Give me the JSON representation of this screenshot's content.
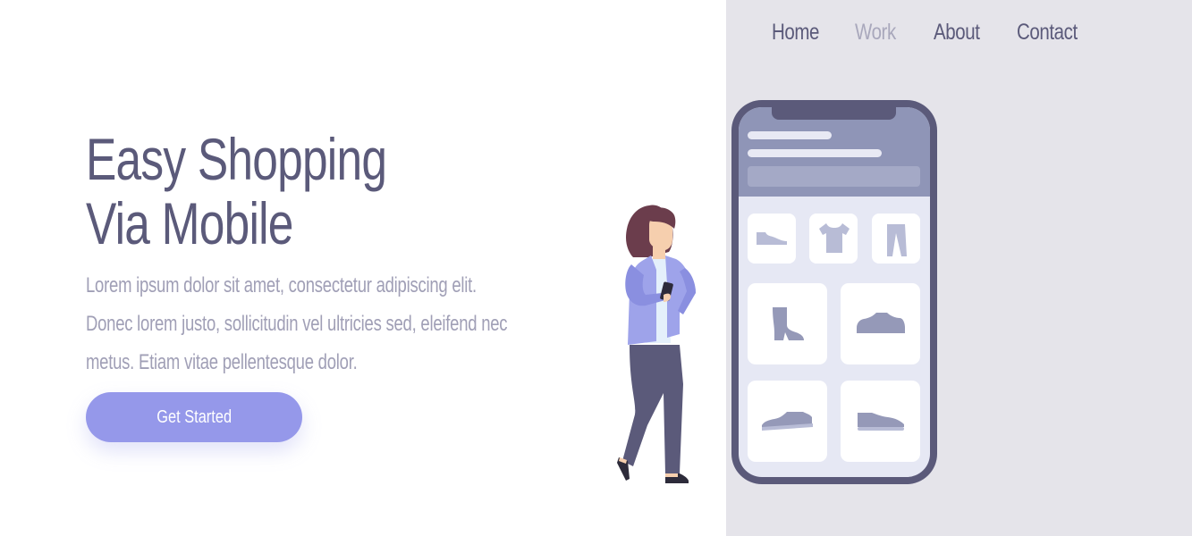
{
  "nav": {
    "items": [
      {
        "label": "Home",
        "active": false
      },
      {
        "label": "Work",
        "active": true
      },
      {
        "label": "About",
        "active": false
      },
      {
        "label": "Contact",
        "active": false
      }
    ]
  },
  "hero": {
    "title_line1": "Easy Shopping",
    "title_line2": "Via Mobile",
    "description": "Lorem ipsum dolor sit amet, consectetur adipiscing elit. Donec lorem justo, sollicitudin vel ultricies sed, eleifend nec metus. Etiam vitae pellentesque dolor.",
    "cta_label": "Get Started"
  },
  "illustration": {
    "phone_products": [
      "flat-shoe-icon",
      "tshirt-icon",
      "pants-icon",
      "boot-icon",
      "sneaker-icon",
      "sneaker-icon",
      "sneaker-icon"
    ],
    "figure": "woman-with-phone"
  },
  "colors": {
    "primary_text": "#5b5a7a",
    "muted_text": "#a09fb6",
    "accent": "#9598ea",
    "panel_bg": "#e5e4ea",
    "phone_frame": "#5b5a7a"
  }
}
